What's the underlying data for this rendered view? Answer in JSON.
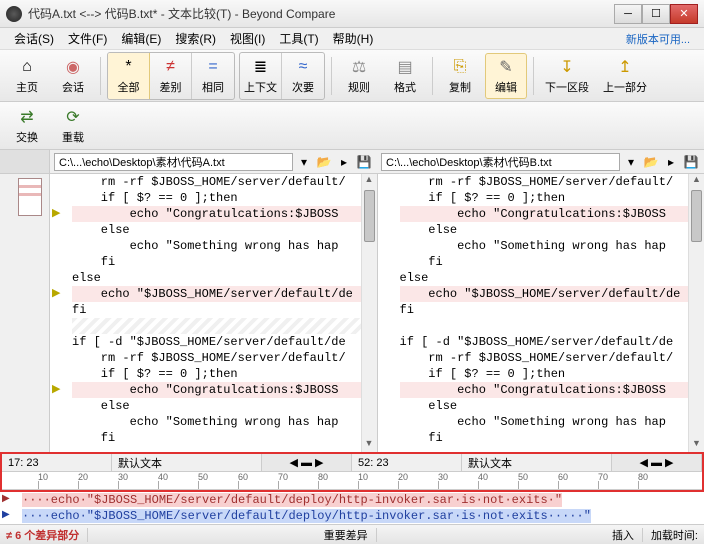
{
  "window": {
    "title": "代码A.txt <--> 代码B.txt* - 文本比较(T) - Beyond Compare"
  },
  "menu": {
    "session": "会话(S)",
    "file": "文件(F)",
    "edit": "编辑(E)",
    "search": "搜索(R)",
    "view": "视图(I)",
    "tools": "工具(T)",
    "help": "帮助(H)",
    "update": "新版本可用..."
  },
  "toolbar": {
    "home": "主页",
    "session": "会话",
    "all": "全部",
    "diff": "差别",
    "same": "相同",
    "context": "上下文",
    "minor": "次要",
    "rules": "规则",
    "format": "格式",
    "copy": "复制",
    "edit": "编辑",
    "next_section": "下一区段",
    "prev_part": "上一部分",
    "swap": "交换",
    "reload": "重载"
  },
  "paths": {
    "left": "C:\\...\\echo\\Desktop\\素材\\代码A.txt",
    "right": "C:\\...\\echo\\Desktop\\素材\\代码B.txt"
  },
  "ruler": {
    "posL": "17: 23",
    "posR": "52: 23",
    "mode": "默认文本",
    "ticks": [
      "10",
      "20",
      "30",
      "40",
      "50",
      "60",
      "70",
      "80",
      "10",
      "20",
      "30",
      "40",
      "50",
      "60",
      "70",
      "80"
    ]
  },
  "code": {
    "left": [
      {
        "t": "    rm -rf $JBOSS_HOME/server/default/",
        "d": false
      },
      {
        "t": "    if [ $? == 0 ];then",
        "d": false
      },
      {
        "t": "        echo \"Congratulcations:$JBOSS",
        "d": true,
        "a": "▶"
      },
      {
        "t": "    else",
        "d": false
      },
      {
        "t": "        echo \"Something wrong has hap",
        "d": false
      },
      {
        "t": "    fi",
        "d": false
      },
      {
        "t": "else",
        "d": false
      },
      {
        "t": "    echo \"$JBOSS_HOME/server/default/de",
        "d": true,
        "a": "▶"
      },
      {
        "t": "fi",
        "d": false
      },
      {
        "t": "",
        "d": false,
        "hatch": true
      },
      {
        "t": "if [ -d \"$JBOSS_HOME/server/default/de",
        "d": false
      },
      {
        "t": "    rm -rf $JBOSS_HOME/server/default/",
        "d": false
      },
      {
        "t": "    if [ $? == 0 ];then",
        "d": false
      },
      {
        "t": "        echo \"Congratulcations:$JBOSS",
        "d": true,
        "a": "▶"
      },
      {
        "t": "    else",
        "d": false
      },
      {
        "t": "        echo \"Something wrong has hap",
        "d": false
      },
      {
        "t": "    fi",
        "d": false
      }
    ],
    "right": [
      {
        "t": "    rm -rf $JBOSS_HOME/server/default/",
        "d": false
      },
      {
        "t": "    if [ $? == 0 ];then",
        "d": false
      },
      {
        "t": "        echo \"Congratulcations:$JBOSS",
        "d": true
      },
      {
        "t": "    else",
        "d": false
      },
      {
        "t": "        echo \"Something wrong has hap",
        "d": false
      },
      {
        "t": "    fi",
        "d": false
      },
      {
        "t": "else",
        "d": false
      },
      {
        "t": "    echo \"$JBOSS_HOME/server/default/de",
        "d": true
      },
      {
        "t": "fi",
        "d": false
      },
      {
        "t": "",
        "d": false
      },
      {
        "t": "if [ -d \"$JBOSS_HOME/server/default/de",
        "d": false
      },
      {
        "t": "    rm -rf $JBOSS_HOME/server/default/",
        "d": false
      },
      {
        "t": "    if [ $? == 0 ];then",
        "d": false
      },
      {
        "t": "        echo \"Congratulcations:$JBOSS",
        "d": true
      },
      {
        "t": "    else",
        "d": false
      },
      {
        "t": "        echo \"Something wrong has hap",
        "d": false
      },
      {
        "t": "    fi",
        "d": false
      }
    ]
  },
  "diff_detail": {
    "line1": "····echo·\"$JBOSS_HOME/server/default/deploy/http-invoker.sar·is·not·exits·\"",
    "line2": "····echo·\"$JBOSS_HOME/server/default/deploy/http-invoker.sar·is·not·exits·····\""
  },
  "status": {
    "diffs": "≠ 6 个差异部分",
    "major": "重要差异",
    "insert": "插入",
    "load": "加载时间:"
  }
}
